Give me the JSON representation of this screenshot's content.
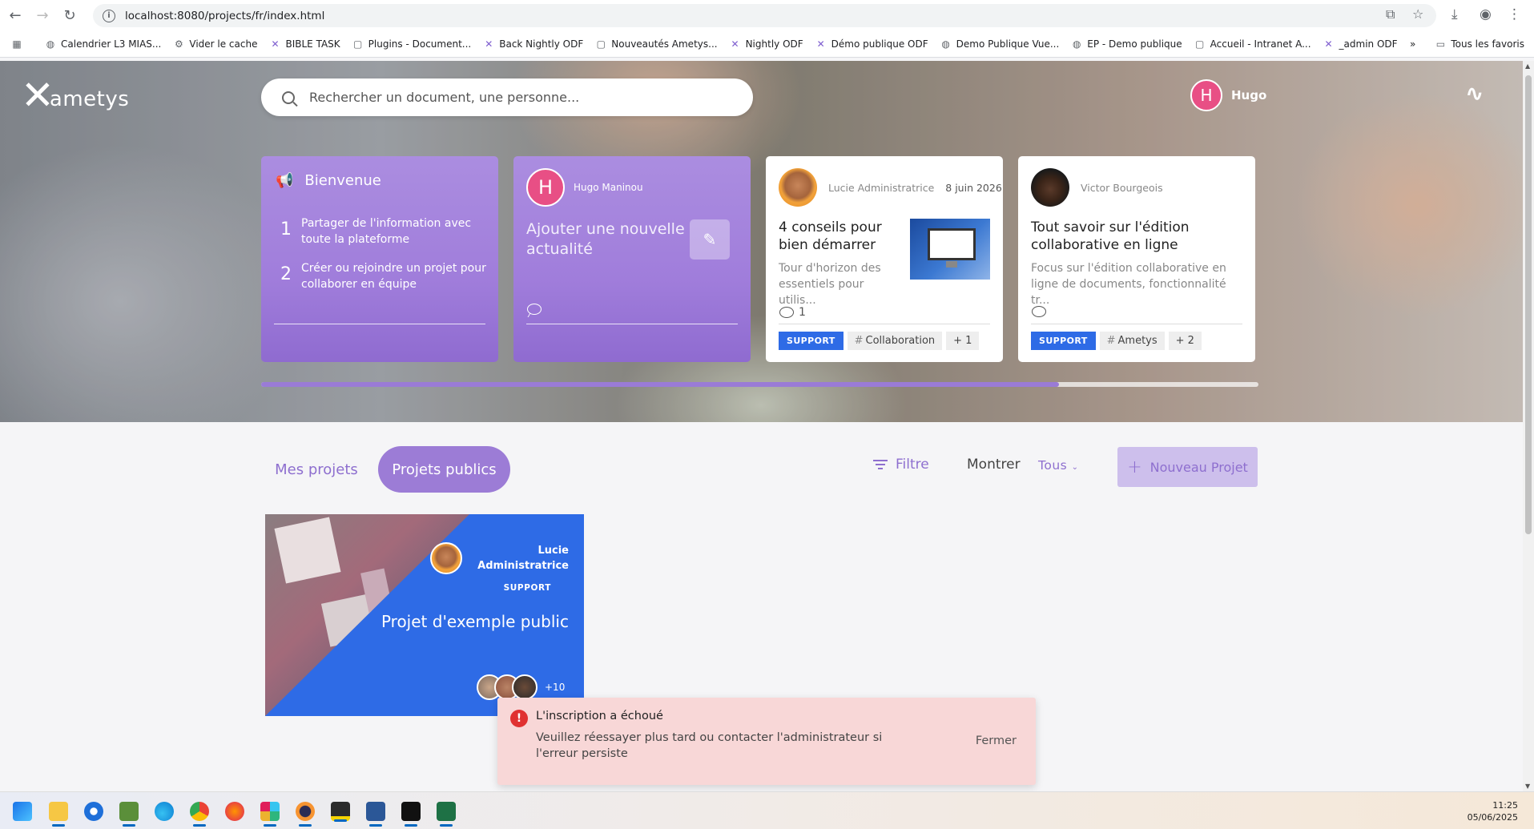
{
  "browser": {
    "url": "localhost:8080/projects/fr/index.html",
    "bookmarks": [
      "Calendrier L3 MIAS...",
      "Vider le cache",
      "BIBLE TASK",
      "Plugins - Document...",
      "Back Nightly ODF",
      "Nouveautés Ametys...",
      "Nightly ODF",
      "Démo publique ODF",
      "Demo Publique Vue...",
      "EP - Demo publique",
      "Accueil - Intranet A...",
      "_admin ODF"
    ],
    "all_bookmarks": "Tous les favoris",
    "overflow": "»"
  },
  "header": {
    "logo_text": "ametys",
    "search_placeholder": "Rechercher un document, une personne...",
    "user_initial": "H",
    "user_name": "Hugo"
  },
  "cards": {
    "welcome": {
      "title": "Bienvenue",
      "steps": [
        {
          "n": "1",
          "text": "Partager de l'information avec toute la plateforme"
        },
        {
          "n": "2",
          "text": "Créer ou rejoindre un projet pour collaborer en équipe"
        }
      ]
    },
    "new_news": {
      "initial": "H",
      "author": "Hugo Maninou",
      "text": "Ajouter une nouvelle actualité"
    },
    "news1": {
      "author": "Lucie Administratrice",
      "date": "8 juin 2026",
      "title": "4 conseils pour bien démarrer",
      "desc": "Tour d'horizon des essentiels pour utilis...",
      "comments": "1",
      "tag_support": "SUPPORT",
      "tag": "Collaboration",
      "more": "+ 1"
    },
    "news2": {
      "author": "Victor Bourgeois",
      "title": "Tout savoir sur l'édition collaborative en ligne",
      "desc": "Focus sur l'édition collaborative en ligne de documents, fonctionnalité tr...",
      "tag_support": "SUPPORT",
      "tag": "Ametys",
      "more": "+ 2"
    },
    "carousel_progress": 0.8
  },
  "projects": {
    "tab_mine": "Mes projets",
    "tab_public": "Projets publics",
    "filter": "Filtre",
    "show_label": "Montrer",
    "show_value": "Tous",
    "new_project": "Nouveau Projet",
    "items": [
      {
        "owner": "Lucie Administratrice",
        "category": "SUPPORT",
        "title": "Projet d'exemple public",
        "members_more": "+10"
      }
    ]
  },
  "toast": {
    "title": "L'inscription a échoué",
    "message": "Veuillez réessayer plus tard ou contacter l'administrateur si l'erreur persiste",
    "close": "Fermer"
  },
  "taskbar": {
    "time": "11:25",
    "date": "05/06/2025"
  }
}
